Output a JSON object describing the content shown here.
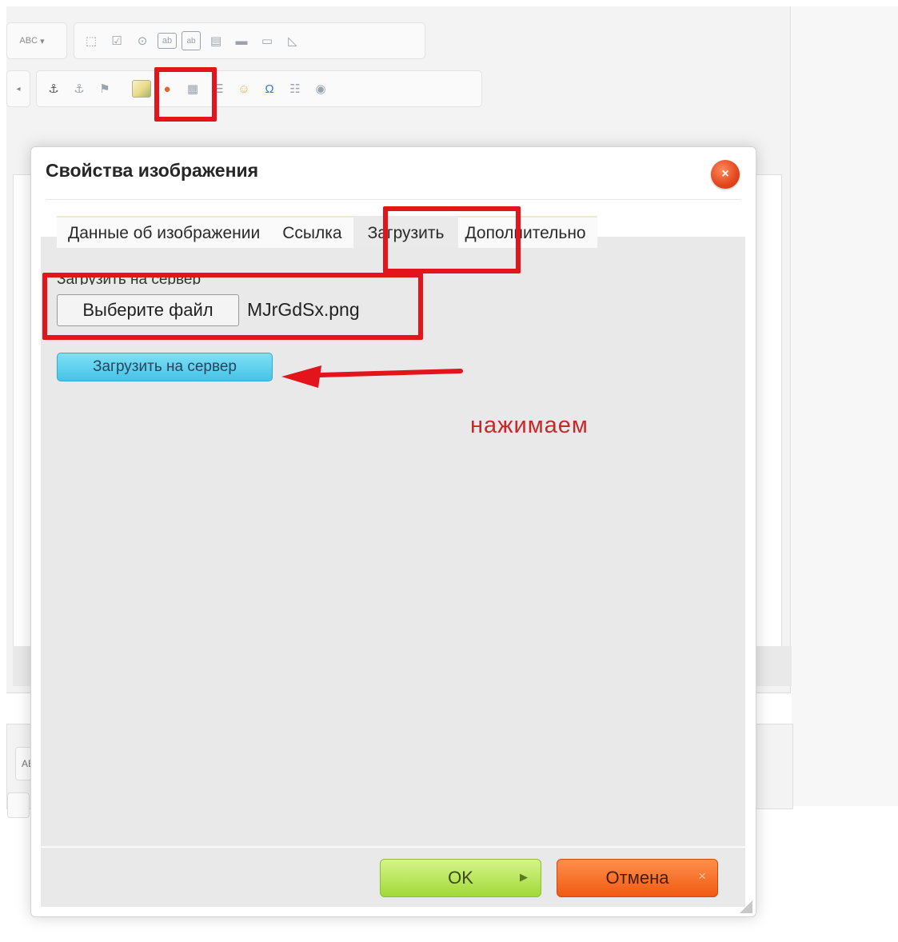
{
  "toolbar": {
    "row1": [
      "spellcheck-icon",
      "form-icon",
      "checkbox-icon",
      "radio-icon",
      "textfield-icon",
      "textarea-icon",
      "select-icon",
      "button-icon",
      "imagebutton-icon",
      "hiddenfield-icon"
    ],
    "row2": [
      "anchor-icon",
      "unlink-icon",
      "flag-icon",
      "image-icon",
      "flash-icon",
      "table-icon",
      "hr-icon",
      "smiley-icon",
      "specialchar-icon",
      "pagebreak-icon",
      "iframe-icon"
    ],
    "spell_label": "ABC",
    "omega": "Ω"
  },
  "dialog": {
    "title": "Свойства изображения",
    "close_symbol": "×",
    "tabs": [
      "Данные об изображении",
      "Ссылка",
      "Загрузить",
      "Дополнительно"
    ],
    "active_tab": "Загрузить",
    "upload_label": "Загрузить на сервер",
    "file_button_label": "Выберите файл",
    "file_name": "MJrGdSx.png",
    "upload_button_label": "Загрузить на сервер",
    "ok_label": "OK",
    "cancel_label": "Отмена"
  },
  "annotation": {
    "text": "нажимаем",
    "color": "#c42a2a",
    "highlight_color": "#e3141b"
  },
  "second_editor": {
    "spell_label": "AB"
  }
}
